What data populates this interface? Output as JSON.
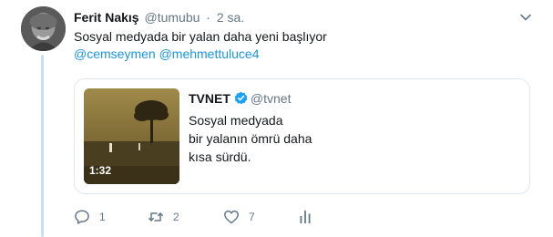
{
  "tweet": {
    "author_name": "Ferit Nakış",
    "author_handle": "@tumubu",
    "separator": "·",
    "time": "2 sa.",
    "text": "Sosyal medyada bir yalan daha yeni başlıyor",
    "mentions": [
      "@cemseymen",
      "@mehmettuluce4"
    ]
  },
  "quoted": {
    "name": "TVNET",
    "handle": "@tvnet",
    "lines": [
      "Sosyal medyada",
      "bir yalanın ömrü daha",
      "kısa sürdü."
    ],
    "video_duration": "1:32"
  },
  "actions": {
    "reply_count": "1",
    "retweet_count": "2",
    "like_count": "7"
  },
  "colors": {
    "link": "#1b95e0",
    "muted": "#657786",
    "thread_line": "#c4e0f5",
    "verified": "#1da1f2"
  }
}
